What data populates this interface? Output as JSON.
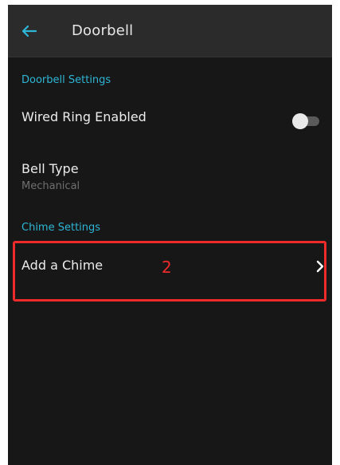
{
  "appbar": {
    "title": "Doorbell",
    "back_icon": "arrow-left-icon",
    "accent_color": "#2eb6d6"
  },
  "sections": {
    "doorbell_settings": {
      "header": "Doorbell Settings",
      "wired_ring": {
        "label": "Wired Ring Enabled",
        "enabled": false
      },
      "bell_type": {
        "label": "Bell Type",
        "value": "Mechanical"
      }
    },
    "chime_settings": {
      "header": "Chime Settings",
      "add_chime": {
        "label": "Add a Chime",
        "icon": "chevron-right-icon"
      }
    }
  },
  "annotation": {
    "number": "2",
    "color": "#ee2a2a"
  }
}
